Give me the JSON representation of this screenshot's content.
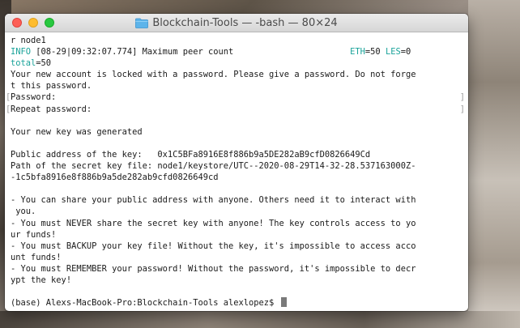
{
  "window": {
    "title": "Blockchain-Tools — -bash — 80×24"
  },
  "terminal": {
    "lines": [
      {
        "text": "r node1"
      },
      {
        "type": "info",
        "level": "INFO",
        "rest": " [08-29|09:32:07.774] Maximum peer count                       ",
        "k1": "ETH",
        "v1": "=50 ",
        "k2": "LES",
        "v2": "=0"
      },
      {
        "type": "total",
        "k": "total",
        "v": "=50"
      },
      {
        "text": "Your new account is locked with a password. Please give a password. Do not forge"
      },
      {
        "text": "t this password."
      },
      {
        "text": "Password:",
        "bracket": true
      },
      {
        "text": "Repeat password:",
        "bracket": true
      },
      {
        "text": ""
      },
      {
        "text": "Your new key was generated"
      },
      {
        "text": ""
      },
      {
        "text": "Public address of the key:   0x1C5BFa8916E8f886b9a5DE282aB9cfD0826649Cd"
      },
      {
        "text": "Path of the secret key file: node1/keystore/UTC--2020-08-29T14-32-28.537163000Z-"
      },
      {
        "text": "-1c5bfa8916e8f886b9a5de282ab9cfd0826649cd"
      },
      {
        "text": ""
      },
      {
        "text": "- You can share your public address with anyone. Others need it to interact with"
      },
      {
        "text": " you."
      },
      {
        "text": "- You must NEVER share the secret key with anyone! The key controls access to yo"
      },
      {
        "text": "ur funds!"
      },
      {
        "text": "- You must BACKUP your key file! Without the key, it's impossible to access acco"
      },
      {
        "text": "unt funds!"
      },
      {
        "text": "- You must REMEMBER your password! Without the password, it's impossible to decr"
      },
      {
        "text": "ypt the key!"
      },
      {
        "text": ""
      }
    ],
    "prompt": "(base) Alexs-MacBook-Pro:Blockchain-Tools alexlopez$ "
  },
  "colors": {
    "info": "#1aa39a",
    "close": "#fd5f57",
    "minimize": "#febc2e",
    "maximize": "#28c840"
  }
}
